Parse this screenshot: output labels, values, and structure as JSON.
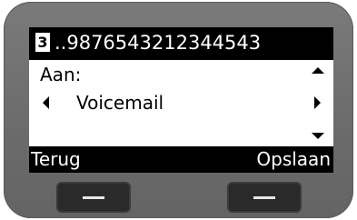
{
  "status": {
    "line_badge": "3",
    "number": "..9876543212344543"
  },
  "content": {
    "field_label": "Aan:",
    "field_value": "Voicemail"
  },
  "softkeys": {
    "left": "Terug",
    "right": "Opslaan"
  },
  "icons": {
    "scroll_up": "triangle-up",
    "scroll_down": "triangle-down",
    "select_prev": "triangle-left",
    "select_next": "triangle-right"
  }
}
